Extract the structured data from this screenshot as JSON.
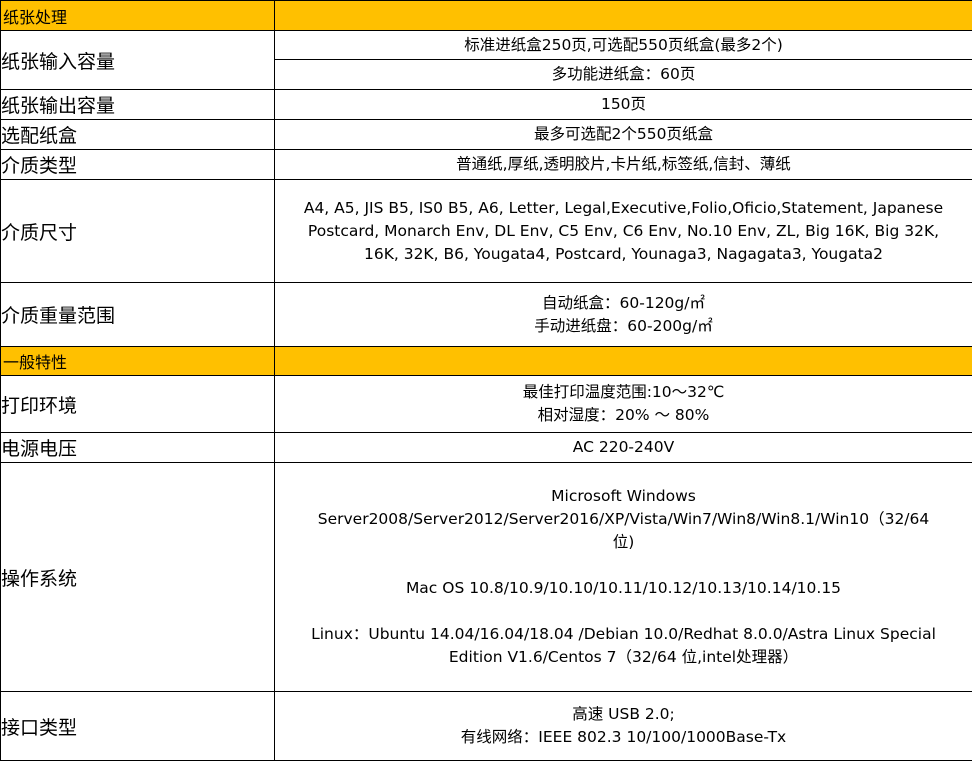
{
  "sections": [
    {
      "title": "纸张处理",
      "rows": [
        {
          "label": "纸张输入容量",
          "values": [
            "标准进纸盒250页,可选配550页纸盒(最多2个)",
            "多功能进纸盒：60页"
          ]
        },
        {
          "label": "纸张输出容量",
          "value": "150页"
        },
        {
          "label": "选配纸盒",
          "value": "最多可选配2个550页纸盒"
        },
        {
          "label": "介质类型",
          "value": "普通纸,厚纸,透明胶片,卡片纸,标签纸,信封、薄纸"
        },
        {
          "label": "介质尺寸",
          "lines": [
            "A4, A5, JIS B5, IS0 B5, A6, Letter, Legal,Executive,Folio,Oficio,Statement, Japanese",
            "Postcard, Monarch Env, DL Env, C5 Env, C6 Env, No.10 Env, ZL, Big 16K, Big 32K,",
            "16K, 32K, B6, Yougata4, Postcard, Younaga3, Nagagata3, Yougata2"
          ]
        },
        {
          "label": "介质重量范围",
          "lines": [
            "自动纸盒：60-120g/㎡",
            "手动进纸盘：60-200g/㎡"
          ]
        }
      ]
    },
    {
      "title": "一般特性",
      "rows": [
        {
          "label": "打印环境",
          "lines": [
            "最佳打印温度范围:10～32℃",
            "相对湿度：20% ～ 80%"
          ]
        },
        {
          "label": "电源电压",
          "value": "AC 220-240V"
        },
        {
          "label": "操作系统",
          "windows_lines": [
            "Microsoft Windows",
            "Server2008/Server2012/Server2016/XP/Vista/Win7/Win8/Win8.1/Win10（32/64",
            "位)"
          ],
          "mac": "Mac OS 10.8/10.9/10.10/10.11/10.12/10.13/10.14/10.15",
          "linux_lines": [
            "Linux：Ubuntu 14.04/16.04/18.04 /Debian 10.0/Redhat 8.0.0/Astra Linux Special",
            "Edition V1.6/Centos 7（32/64 位,intel处理器）"
          ]
        },
        {
          "label": "接口类型",
          "lines": [
            "高速 USB 2.0;",
            "有线网络：IEEE 802.3 10/100/1000Base-Tx"
          ]
        }
      ]
    }
  ],
  "colors": {
    "section_header": "#ffc000",
    "border": "#000000"
  }
}
